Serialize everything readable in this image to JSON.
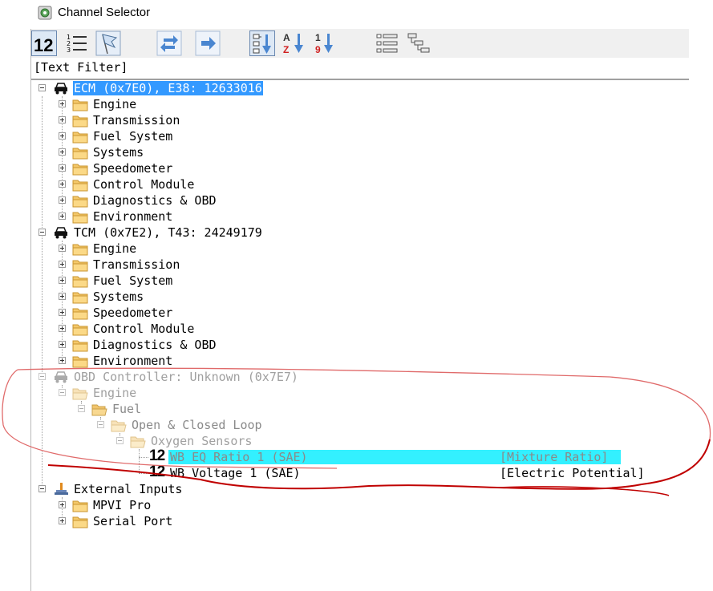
{
  "window": {
    "title": "Channel Selector"
  },
  "toolbar": {
    "buttons": [
      {
        "name": "numeric-view-button",
        "icon": "numeric-12-icon",
        "pressed": true
      },
      {
        "name": "list-view-button",
        "icon": "numbered-list-icon",
        "pressed": false
      },
      {
        "name": "flag-button",
        "icon": "flag-icon",
        "pressed": false
      },
      {
        "name": "swap-button",
        "icon": "swap-arrows-icon",
        "pressed": false
      },
      {
        "name": "forward-button",
        "icon": "arrow-right-icon",
        "pressed": false
      },
      {
        "name": "sort-tree-button",
        "icon": "sort-tree-down-icon",
        "pressed": true
      },
      {
        "name": "sort-alpha-button",
        "icon": "sort-az-icon",
        "pressed": false
      },
      {
        "name": "sort-numeric-button",
        "icon": "sort-19-icon",
        "pressed": false
      },
      {
        "name": "list-detail-button",
        "icon": "list-detail-icon",
        "pressed": false
      },
      {
        "name": "hierarchy-button",
        "icon": "hierarchy-icon",
        "pressed": false
      }
    ]
  },
  "filter": {
    "text": "[Text Filter]"
  },
  "tree": {
    "ecm": {
      "label": "ECM (0x7E0), E38: 12633016",
      "children": [
        "Engine",
        "Transmission",
        "Fuel System",
        "Systems",
        "Speedometer",
        "Control Module",
        "Diagnostics & OBD",
        "Environment"
      ]
    },
    "tcm": {
      "label": "TCM (0x7E2), T43: 24249179",
      "children": [
        "Engine",
        "Transmission",
        "Fuel System",
        "Systems",
        "Speedometer",
        "Control Module",
        "Diagnostics & OBD",
        "Environment"
      ]
    },
    "obd": {
      "label": "OBD Controller: Unknown (0x7E7)",
      "engine": "Engine",
      "fuel": "Fuel",
      "loop": "Open & Closed Loop",
      "sensors": "Oxygen Sensors",
      "channels": [
        {
          "prefix": "12",
          "label": "WB EQ Ratio 1 (SAE)",
          "unit": "[Mixture Ratio]",
          "highlighted": true
        },
        {
          "prefix": "12",
          "label": "WB Voltage 1 (SAE)",
          "unit": "[Electric Potential]",
          "highlighted": false
        }
      ]
    },
    "external": {
      "label": "External Inputs",
      "children": [
        "MPVI Pro",
        "Serial Port"
      ]
    }
  },
  "colors": {
    "selection": "#3399ff",
    "highlight": "#33f0ff",
    "annotation": "#d84a4a",
    "annotation_dark": "#c00000"
  }
}
